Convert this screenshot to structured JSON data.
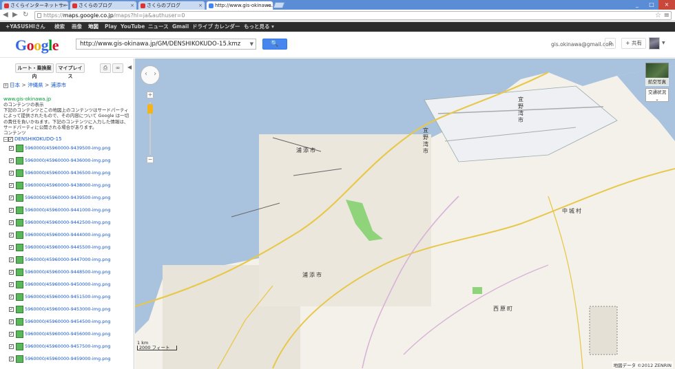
{
  "browser": {
    "tabs": [
      {
        "title": "さくらインターネットサーバコン"
      },
      {
        "title": "さくらのブログ"
      },
      {
        "title": "さくらのブログ"
      },
      {
        "title": "http://www.gis-okinawa.jp"
      }
    ],
    "url_domain": "maps.google.co.jp",
    "url_prefix": "https://",
    "url_rest": "/maps?hl=ja&authuser=0",
    "controls": {
      "minimize": "_",
      "maximize": "□",
      "close": "×"
    }
  },
  "gbar": {
    "items": [
      "+YASUSHIさん",
      "検索",
      "画像",
      "地図",
      "Play",
      "YouTube",
      "ニュース",
      "Gmail",
      "ドライブ",
      "カレンダー",
      "もっと見る ▾"
    ],
    "selected": "地図"
  },
  "header": {
    "logo": "Google",
    "search_value": "http://www.gis-okinawa.jp/GM/DENSHIKOKUDO-15.kmz",
    "search_button": "🔍",
    "account": "gis.okinawa@gmail.com",
    "notif_count": "0",
    "share_label": "+ 共有"
  },
  "panel": {
    "route_button": "ルート・乗換案内",
    "myplaces_button": "マイプレイス",
    "breadcrumb": [
      "日本",
      "沖縄県",
      "浦添市"
    ],
    "source_site": "www.gis-okinawa.jp",
    "content_heading": "のコンテンツの表示",
    "notice": "下記のコンテンツとこの地図上のコンテンツはサードパーティによって提供されたもので、その内容について Google は一切の責任を負いかねます。下記のコンテンツに入力した情報は、サードパーティに公開される場合があります。",
    "contents_label": "コンテンツ",
    "tree_root": "DENSHIKOKUDO-15",
    "layers": [
      "5960000/45960000-9439500-img.png",
      "5960000/45960000-9436000-img.png",
      "5960000/45960000-9436500-img.png",
      "5960000/45960000-9438000-img.png",
      "5960000/45960000-9439500-img.png",
      "5960000/45960000-9441000-img.png",
      "5960000/45960000-9442500-img.png",
      "5960000/45960000-9444000-img.png",
      "5960000/45960000-9445500-img.png",
      "5960000/45960000-9447000-img.png",
      "5960000/45960000-9448500-img.png",
      "5960000/45960000-9450000-img.png",
      "5960000/45960000-9451500-img.png",
      "5960000/45960000-9453000-img.png",
      "5960000/45960000-9454500-img.png",
      "5960000/45960000-9456000-img.png",
      "5960000/45960000-9457500-img.png",
      "5960000/45960000-9459000-img.png"
    ]
  },
  "map": {
    "labels": {
      "urasoe_north": "浦添市",
      "ginowan": "宜野湾市",
      "ginowan_upper": "宜野湾市",
      "nakagusuku": "中城村",
      "urasoe": "浦添市",
      "nishihara": "西原町"
    },
    "satellite_label": "航空写真",
    "traffic_label": "交通状況",
    "scale_top": "1 km",
    "scale_bottom": "2000 フィート",
    "copyright": "地図データ ©2012 ZENRIN",
    "colors": {
      "sea": "#a9c2de",
      "land": "#f3f1ea",
      "park": "#8fd47a",
      "road": "#e8c84a"
    }
  }
}
